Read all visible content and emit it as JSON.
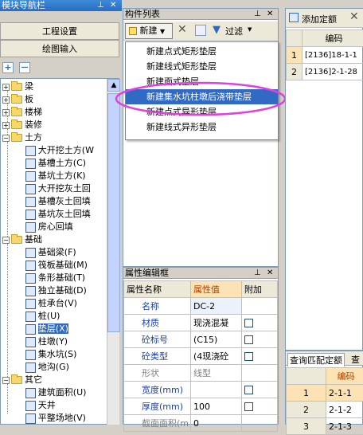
{
  "nav_panel": {
    "title": "模块导航栏",
    "pin": "⊥",
    "close": "✕",
    "btn_project": "工程设置",
    "btn_draw": "绘图输入",
    "add": "+",
    "remove": "—"
  },
  "tree": {
    "top_groups": [
      "梁",
      "板",
      "楼梯",
      "装修"
    ],
    "earth": "土方",
    "earth_items": [
      "大开挖土方(W",
      "基槽土方(C)",
      "基坑土方(K)",
      "大开挖灰土回",
      "基槽灰土回填",
      "基坑灰土回填",
      "房心回填"
    ],
    "foundation": "基础",
    "foundation_items": [
      "基础梁(F)",
      "筏板基础(M)",
      "条形基础(T)",
      "独立基础(D)",
      "桩承台(V)",
      "桩(U)",
      "垫层(X)",
      "柱墩(Y)",
      "集水坑(S)",
      "地沟(G)"
    ],
    "other": "其它",
    "other_items": [
      "建筑面积(U)",
      "天井",
      "平整场地(V)"
    ]
  },
  "component_list": {
    "title": "构件列表",
    "new_button": "新建",
    "filter_button": "过滤",
    "menu": [
      "新建点式矩形垫层",
      "新建线式矩形垫层",
      "新建面式垫层",
      "新建集水坑柱墩后浇带垫层",
      "新建点式异形垫层",
      "新建线式异形垫层"
    ]
  },
  "property_editor": {
    "title": "属性编辑框",
    "headers": [
      "属性名称",
      "属性值",
      "附加"
    ],
    "rows": [
      {
        "name": "名称",
        "value": "DC-2"
      },
      {
        "name": "材质",
        "value": "现浇混凝"
      },
      {
        "name": "砼标号",
        "value": "(C15)"
      },
      {
        "name": "砼类型",
        "value": "(4现浇砼"
      },
      {
        "name": "形状",
        "value": "线型"
      },
      {
        "name": "宽度(mm)",
        "value": ""
      },
      {
        "name": "厚度(mm)",
        "value": "100"
      },
      {
        "name": "截面面积(m",
        "value": "0"
      }
    ]
  },
  "quota_panel": {
    "add_button": "添加定额",
    "col_header": "编码",
    "rows": [
      {
        "num": "1",
        "code": "[2136]18-1-1"
      },
      {
        "num": "2",
        "code": "[2136]2-1-28"
      }
    ]
  },
  "query_panel": {
    "tab1": "查询匹配定额",
    "tab2": "查询",
    "col_header": "编码",
    "rows": [
      {
        "num": "1",
        "code": "2-1-1"
      },
      {
        "num": "2",
        "code": "2-1-2"
      },
      {
        "num": "3",
        "code": "2-1-3"
      }
    ]
  },
  "colors": {
    "title_blue": "#2a6cc0",
    "highlight": "#316ac5",
    "ellipse": "#e040e0"
  }
}
